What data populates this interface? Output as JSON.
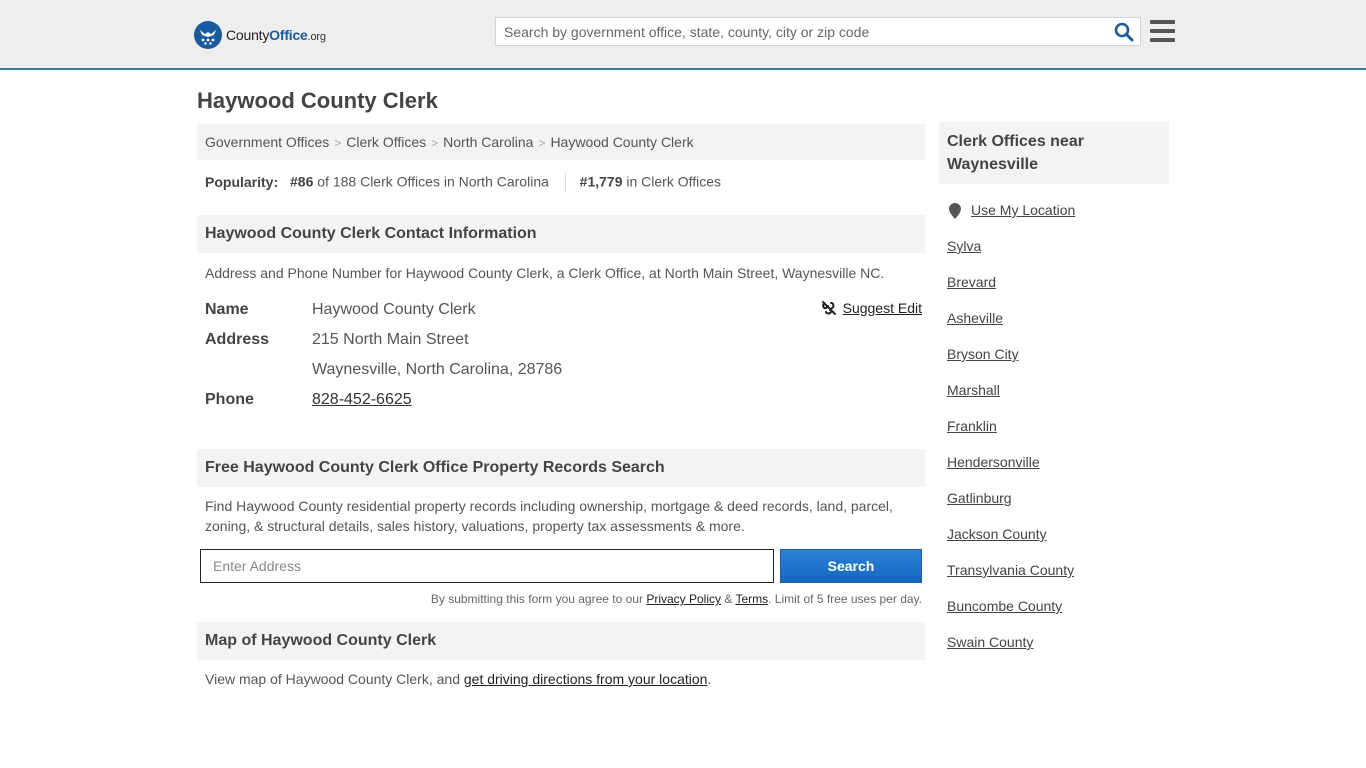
{
  "header": {
    "logo": {
      "part1": "County",
      "part2": "Office",
      "part3": ".org"
    },
    "search_placeholder": "Search by government office, state, county, city or zip code",
    "search_icon": "search-icon",
    "menu_icon": "hamburger-menu-icon"
  },
  "page_title": "Haywood County Clerk",
  "breadcrumb": [
    {
      "label": "Government Offices"
    },
    {
      "label": "Clerk Offices"
    },
    {
      "label": "North Carolina"
    },
    {
      "label": "Haywood County Clerk"
    }
  ],
  "popularity": {
    "label": "Popularity:",
    "state_rank": "#86",
    "state_rank_text": "of 188 Clerk Offices in North Carolina",
    "national_rank": "#1,779",
    "national_rank_text": "in Clerk Offices"
  },
  "contact": {
    "heading": "Haywood County Clerk Contact Information",
    "description": "Address and Phone Number for Haywood County Clerk, a Clerk Office, at North Main Street, Waynesville NC.",
    "suggest_edit": "Suggest Edit",
    "fields": {
      "name_label": "Name",
      "name_value": "Haywood County Clerk",
      "address_label": "Address",
      "address_line1": "215 North Main Street",
      "address_line2": "Waynesville, North Carolina, 28786",
      "phone_label": "Phone",
      "phone_value": "828-452-6625"
    }
  },
  "property": {
    "heading": "Free Haywood County Clerk Office Property Records Search",
    "description": "Find Haywood County residential property records including ownership, mortgage & deed records, land, parcel, zoning, & structural details, sales history, valuations, property tax assessments & more.",
    "address_placeholder": "Enter Address",
    "search_button": "Search",
    "terms_prefix": "By submitting this form you agree to our ",
    "privacy_link": "Privacy Policy",
    "amp": " & ",
    "terms_link": "Terms",
    "terms_suffix": ". Limit of 5 free uses per day."
  },
  "map": {
    "heading": "Map of Haywood County Clerk",
    "description_prefix": "View map of Haywood County Clerk, and ",
    "directions_link": "get driving directions from your location",
    "description_suffix": "."
  },
  "sidebar": {
    "heading": "Clerk Offices near Waynesville",
    "use_location": "Use My Location",
    "links": [
      "Sylva",
      "Brevard",
      "Asheville",
      "Bryson City",
      "Marshall",
      "Franklin",
      "Hendersonville",
      "Gatlinburg",
      "Jackson County",
      "Transylvania County",
      "Buncombe County",
      "Swain County"
    ]
  },
  "colors": {
    "brand_blue": "#1a5a9e",
    "header_border": "#3a7caa",
    "button_blue": "#1e74c9"
  }
}
